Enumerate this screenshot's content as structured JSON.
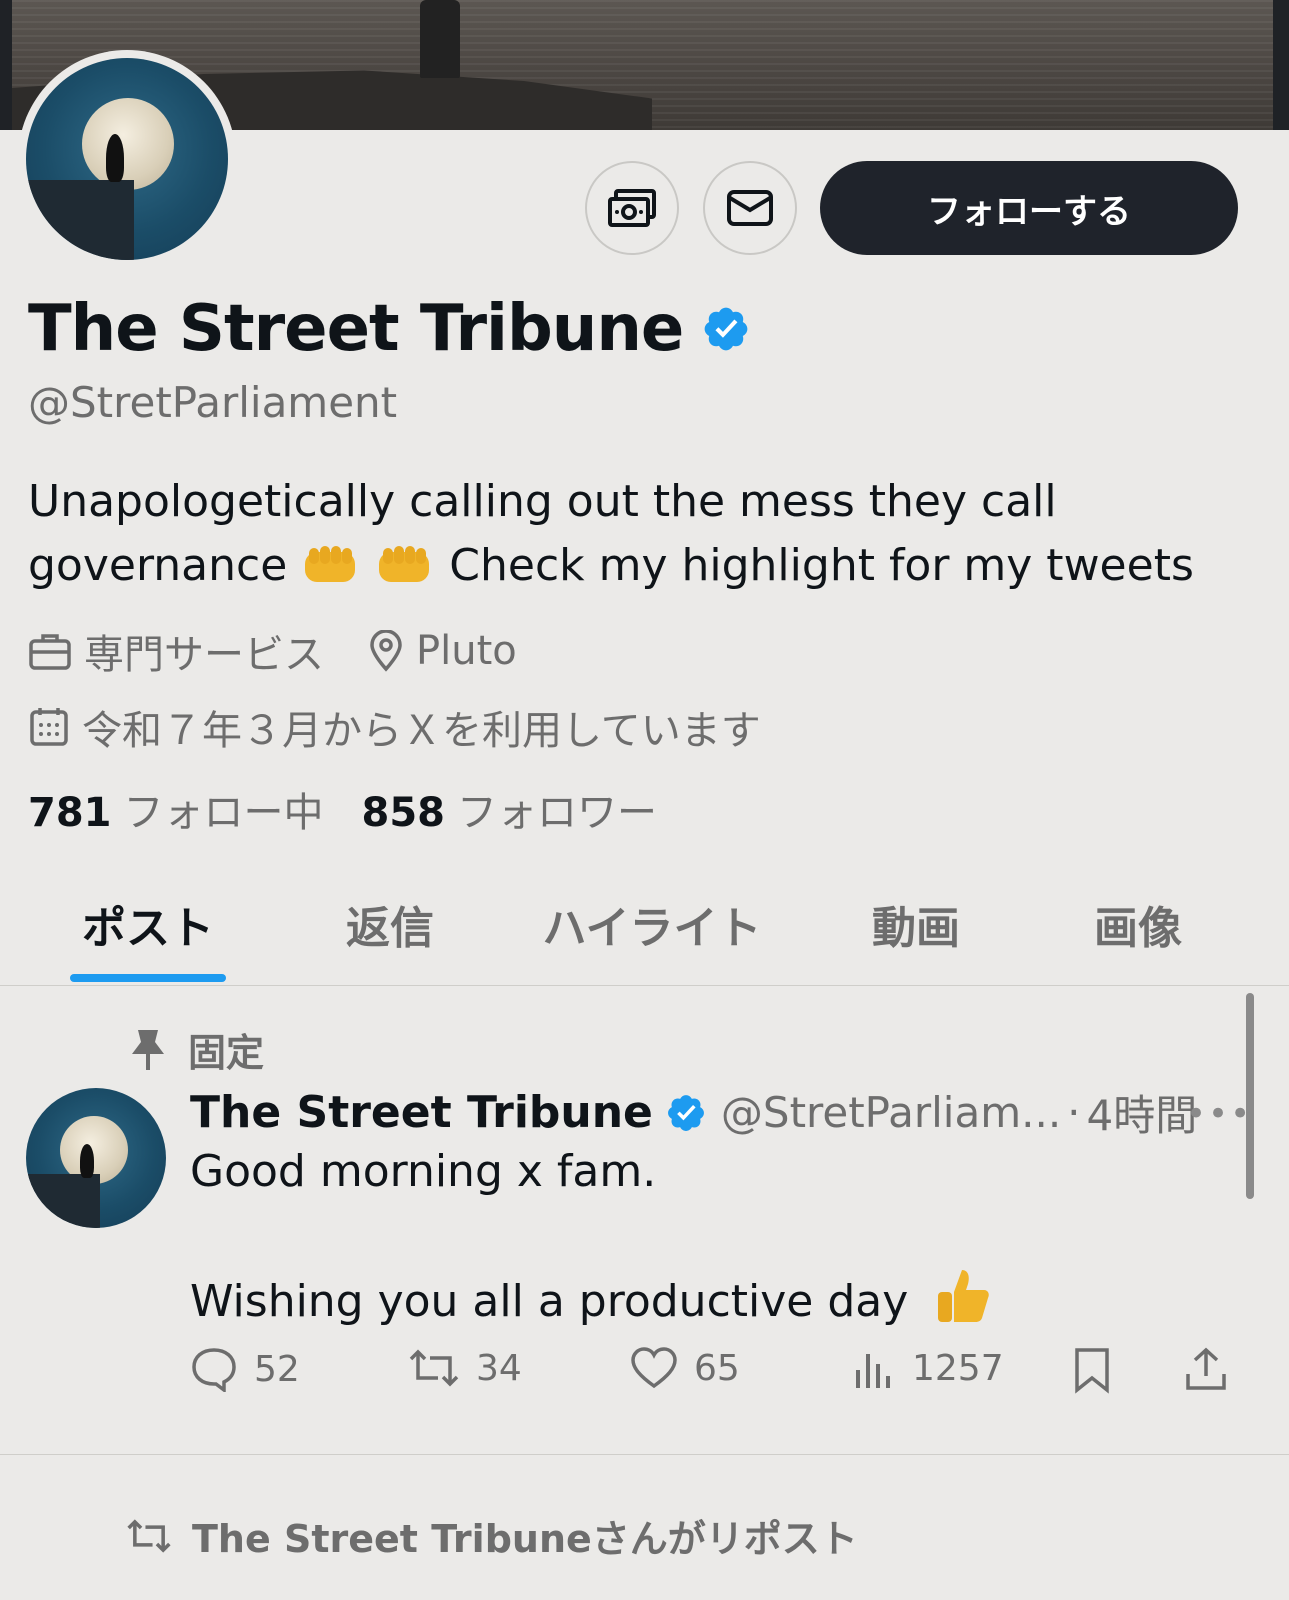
{
  "profile": {
    "follow_label": "フォローする",
    "display_name": "The Street Tribune",
    "handle": "@StretParliament",
    "bio_line1": "Unapologetically calling out the mess they call",
    "bio_line2_pre": "governance",
    "bio_line2_post": "Check my highlight for my tweets",
    "category": "専門サービス",
    "location": "Pluto",
    "joined": "令和７年３月からＸを利用しています",
    "following_count": "781",
    "following_label": "フォロー中",
    "followers_count": "858",
    "followers_label": "フォロワー"
  },
  "tabs": [
    {
      "label": "ポスト",
      "active": true
    },
    {
      "label": "返信",
      "active": false
    },
    {
      "label": "ハイライト",
      "active": false
    },
    {
      "label": "動画",
      "active": false
    },
    {
      "label": "画像",
      "active": false
    }
  ],
  "pinned_post": {
    "pinned_label": "固定",
    "author_name": "The Street Tribune",
    "author_handle": "@StretParliam...",
    "separator": "·",
    "time": "4時間",
    "text_line1": "Good morning x fam.",
    "text_line2": "Wishing you all a productive day",
    "replies": "52",
    "reposts": "34",
    "likes": "65",
    "views": "1257"
  },
  "next_post": {
    "repost_note": "The Street Tribuneさんがリポスト"
  },
  "colors": {
    "background": "#ebeae8",
    "verified_blue": "#1d9bf0",
    "follow_button": "#1f232b",
    "secondary_text": "#6d6d6d"
  },
  "icons": {
    "tip": "money-icon",
    "message": "mail-icon",
    "verified": "verified-badge-icon",
    "category": "briefcase-icon",
    "location": "location-pin-icon",
    "joined": "calendar-icon",
    "pinned": "pin-icon",
    "reply": "reply-icon",
    "repost": "repost-icon",
    "like": "heart-icon",
    "views": "views-icon",
    "bookmark": "bookmark-icon",
    "share": "share-icon"
  }
}
